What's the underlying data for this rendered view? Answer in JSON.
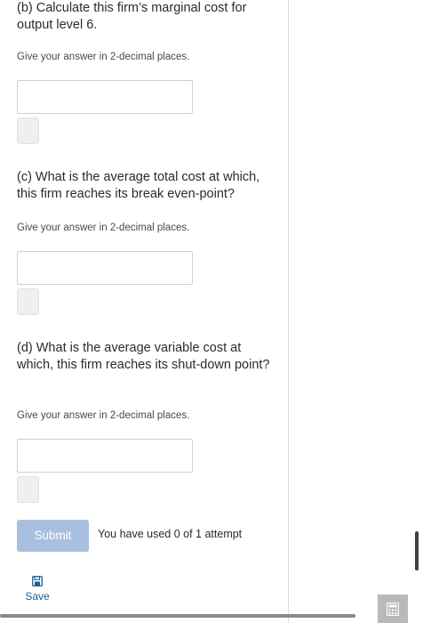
{
  "questions": [
    {
      "prompt": "(b) Calculate this firm’s marginal cost for output level 6.",
      "hint": "Give your answer in 2-decimal places.",
      "answer_value": ""
    },
    {
      "prompt": "(c) What is the average total cost at which, this firm reaches its break even-point?",
      "hint": "Give your answer in 2-decimal places.",
      "answer_value": ""
    },
    {
      "prompt": "(d) What is the average variable cost at which, this firm reaches its shut-down point?",
      "hint": "Give your answer in 2-decimal places.",
      "answer_value": ""
    }
  ],
  "footer": {
    "submit_label": "Submit",
    "attempts_text": "You have used 0 of 1 attempt",
    "save_label": "Save"
  },
  "icons": {
    "save": "save-icon",
    "calculator": "calculator-icon"
  },
  "colors": {
    "submit_button": "#a9bfdf",
    "save_link": "#1e5a96"
  }
}
